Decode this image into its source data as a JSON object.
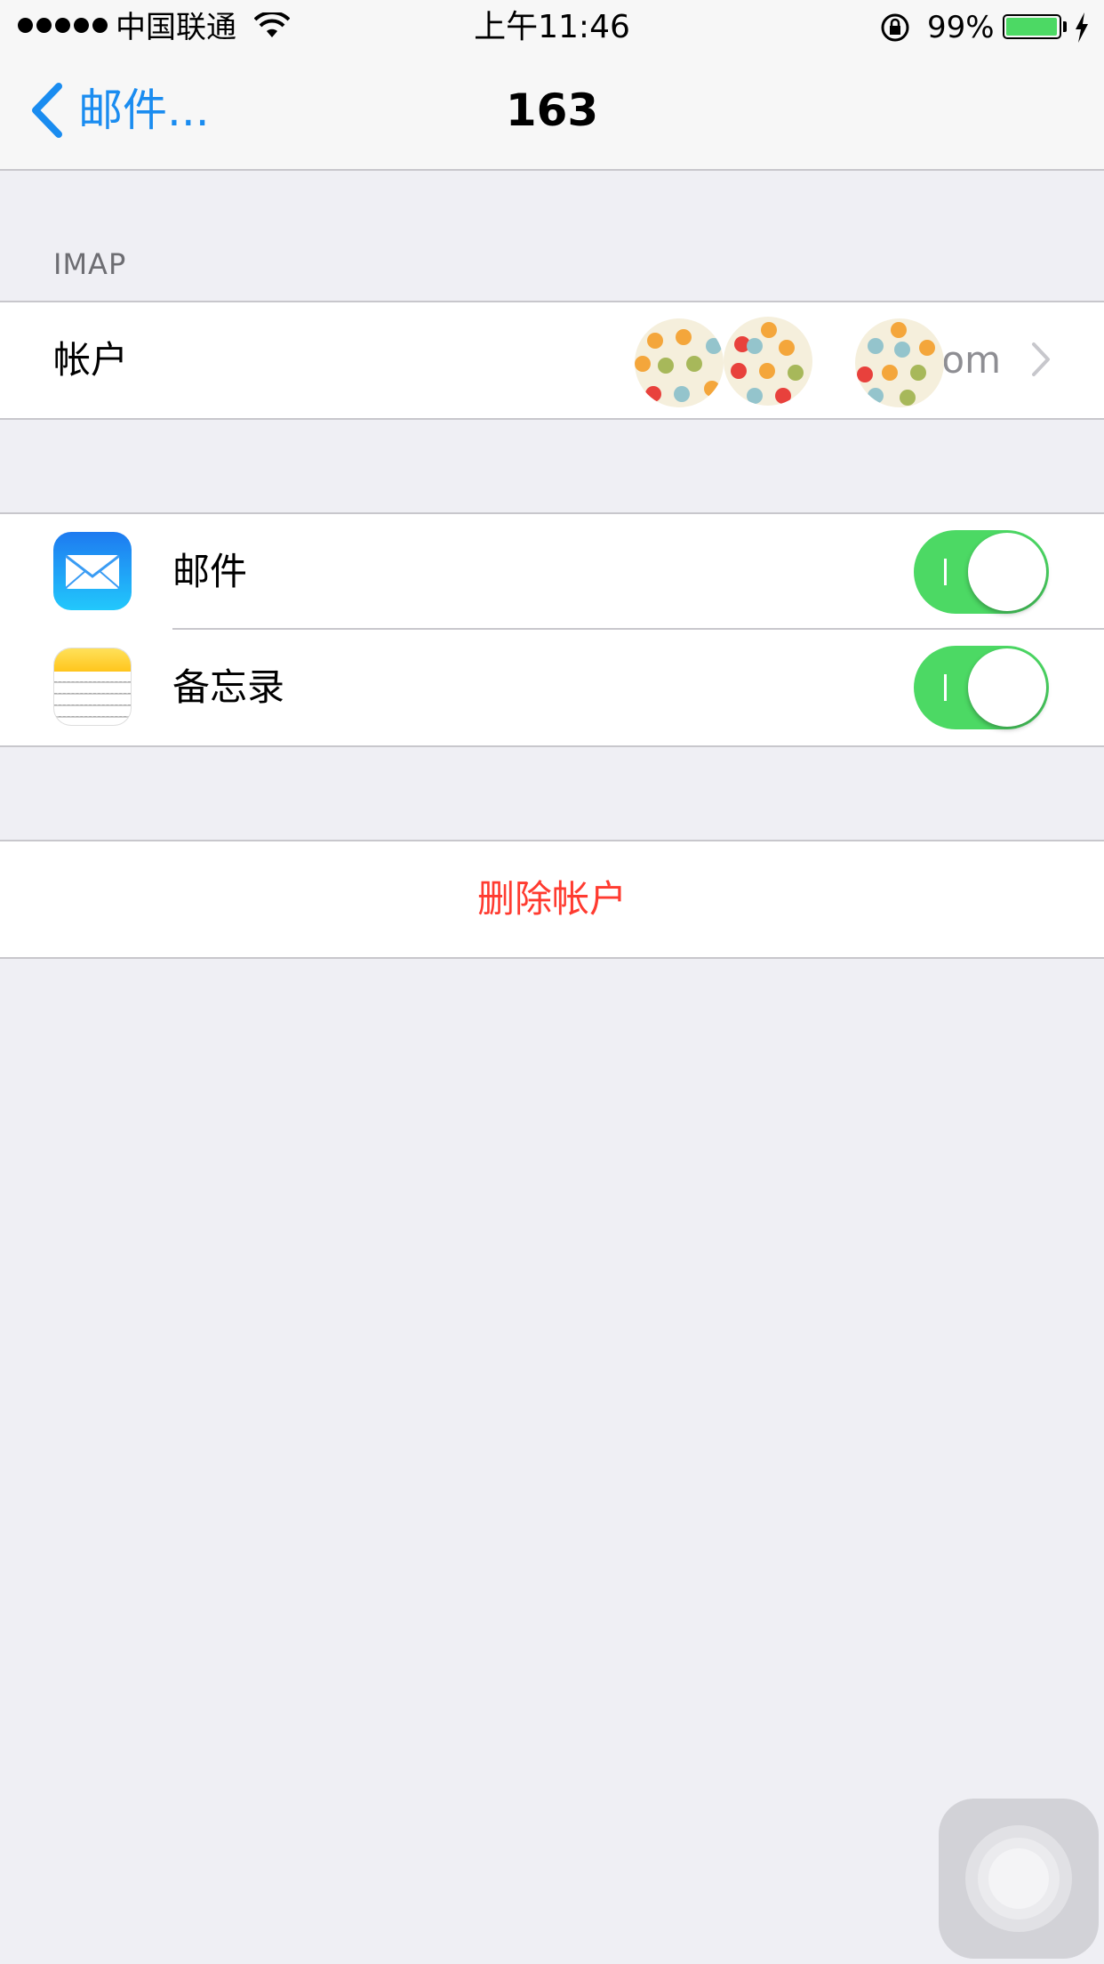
{
  "status_bar": {
    "carrier": "中国联通",
    "time": "上午11:46",
    "battery_percent": "99%",
    "battery_level": 0.99,
    "icons": [
      "signal-dots-icon",
      "wifi-icon",
      "rotation-lock-icon",
      "battery-icon",
      "charging-bolt-icon"
    ]
  },
  "nav": {
    "back_label": "邮件...",
    "title": "163"
  },
  "imap_section": {
    "header": "IMAP",
    "account_label": "帐户",
    "account_value": "q@      om"
  },
  "apps": [
    {
      "label": "邮件",
      "icon": "mail-app-icon",
      "enabled": true
    },
    {
      "label": "备忘录",
      "icon": "notes-app-icon",
      "enabled": true
    }
  ],
  "delete_account": "删除帐户",
  "colors": {
    "accent": "#1a8cf0",
    "toggle_on": "#4cd964",
    "destructive": "#ff3b30",
    "background": "#efeff4"
  }
}
